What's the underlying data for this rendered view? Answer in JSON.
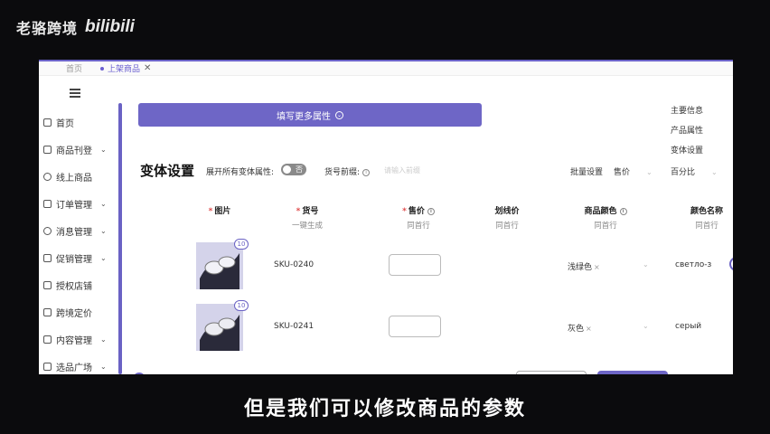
{
  "overlay": {
    "channel_name": "老骆跨境",
    "logo_text": "bilibili",
    "subtitle": "但是我们可以修改商品的参数"
  },
  "tabs": {
    "home": "首页",
    "active": "上架商品",
    "close": "✕"
  },
  "sidebar": {
    "items": [
      {
        "label": "首页",
        "icon": "home-icon",
        "has_chevron": false
      },
      {
        "label": "商品刊登",
        "icon": "box-icon",
        "has_chevron": true
      },
      {
        "label": "线上商品",
        "icon": "upload-icon",
        "has_chevron": false
      },
      {
        "label": "订单管理",
        "icon": "order-icon",
        "has_chevron": true
      },
      {
        "label": "消息管理",
        "icon": "message-icon",
        "has_chevron": true
      },
      {
        "label": "促销管理",
        "icon": "promotion-icon",
        "has_chevron": true
      },
      {
        "label": "授权店铺",
        "icon": "shop-icon",
        "has_chevron": false
      },
      {
        "label": "跨境定价",
        "icon": "pricing-icon",
        "has_chevron": false
      },
      {
        "label": "内容管理",
        "icon": "content-icon",
        "has_chevron": true
      },
      {
        "label": "选品广场",
        "icon": "plaza-icon",
        "has_chevron": true
      }
    ],
    "chevron": "⌄"
  },
  "main": {
    "fill_more_button": "填写更多属性",
    "anchor_nav": [
      "主要信息",
      "产品属性",
      "变体设置"
    ],
    "section_title": "变体设置",
    "expand_all_label": "展开所有变体属性:",
    "toggle_state": "否",
    "sku_prefix_label": "货号前缀:",
    "sku_prefix_placeholder": "请输入前缀",
    "batch_label": "批量设置",
    "batch_field": "售价",
    "batch_mode": "百分比"
  },
  "table": {
    "headers": [
      {
        "label": "图片",
        "sub": "",
        "required": true
      },
      {
        "label": "货号",
        "sub": "一键生成",
        "required": true
      },
      {
        "label": "售价",
        "sub": "同首行",
        "required": true,
        "info": true
      },
      {
        "label": "划线价",
        "sub": "同首行",
        "required": false
      },
      {
        "label": "商品颜色",
        "sub": "同首行",
        "required": false,
        "info": true
      },
      {
        "label": "颜色名称",
        "sub": "同首行",
        "required": false
      }
    ],
    "rows": [
      {
        "badge": "10",
        "sku": "SKU-0240",
        "price": "",
        "color": "浅绿色",
        "color_name": "светло-з"
      },
      {
        "badge": "10",
        "sku": "SKU-0241",
        "price": "",
        "color": "灰色",
        "color_name": "серый"
      }
    ],
    "tag_remove": "×"
  }
}
